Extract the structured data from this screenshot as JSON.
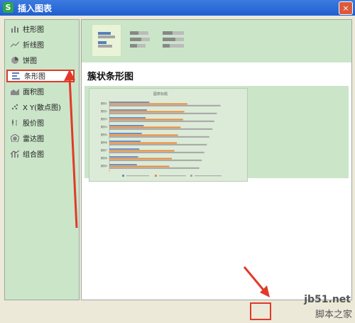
{
  "dialog": {
    "title": "插入图表",
    "close_label": "×"
  },
  "sidebar": {
    "items": [
      {
        "label": "柱形图",
        "icon": "column-chart-icon"
      },
      {
        "label": "折线图",
        "icon": "line-chart-icon"
      },
      {
        "label": "饼图",
        "icon": "pie-chart-icon"
      },
      {
        "label": "条形图",
        "icon": "bar-chart-icon",
        "selected": true
      },
      {
        "label": "面积图",
        "icon": "area-chart-icon"
      },
      {
        "label": "X Y(散点图)",
        "icon": "scatter-chart-icon"
      },
      {
        "label": "股价图",
        "icon": "stock-chart-icon"
      },
      {
        "label": "雷达图",
        "icon": "radar-chart-icon"
      },
      {
        "label": "组合图",
        "icon": "combo-chart-icon"
      }
    ]
  },
  "main": {
    "subtypes": [
      "clustered-bar",
      "stacked-bar",
      "percent-stacked-bar"
    ],
    "heading": "簇状条形图",
    "preview": {
      "title": "图表标题",
      "categories": [
        "类别1",
        "类别2",
        "类别3",
        "类别4",
        "类别5",
        "类别6",
        "类别7",
        "类别8",
        "类别9"
      ],
      "series_colors": [
        "#6d8fc6",
        "#ed8a3c",
        "#a5a5a5"
      ]
    }
  },
  "watermark": {
    "site": "jb51.net",
    "brand": "脚本之家"
  },
  "colors": {
    "accent": "#e03a2a",
    "panel": "#cbe5c9",
    "titlebar": "#2a66d6"
  }
}
